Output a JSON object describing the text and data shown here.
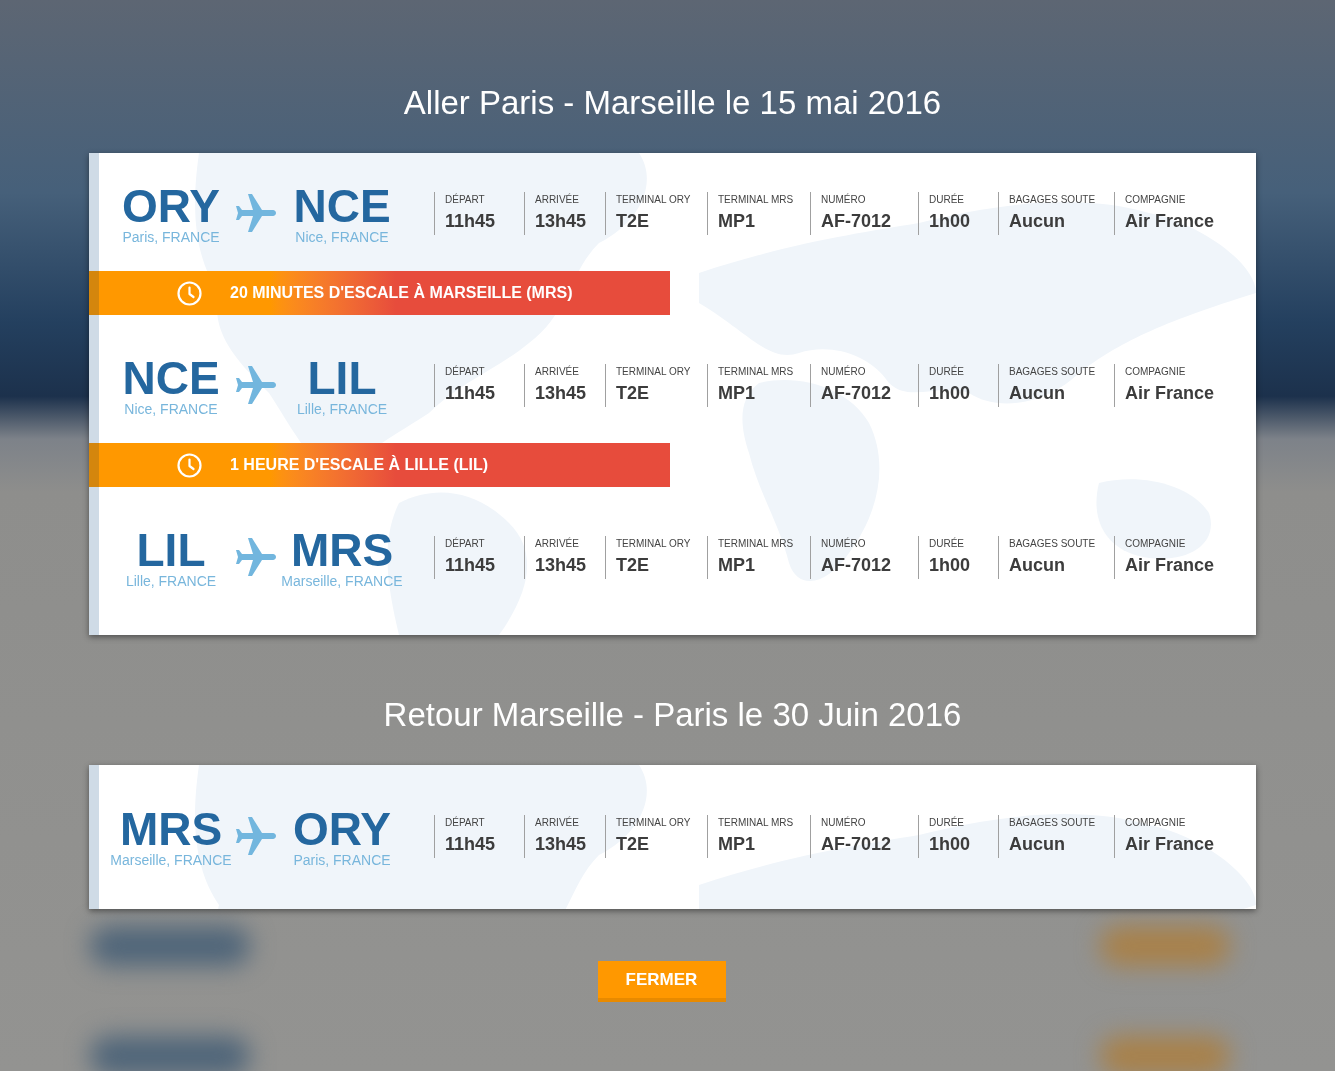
{
  "sections": [
    {
      "title": "Aller Paris - Marseille le 15 mai 2016",
      "legs": [
        {
          "kind": "flight",
          "origin": {
            "code": "ORY",
            "city": "Paris, FRANCE"
          },
          "destination": {
            "code": "NCE",
            "city": "Nice, FRANCE"
          },
          "details": [
            {
              "label": "DÉPART",
              "value": "11h45"
            },
            {
              "label": "ARRIVÉE",
              "value": "13h45"
            },
            {
              "label": "TERMINAL ORY",
              "value": "T2E"
            },
            {
              "label": "TERMINAL MRS",
              "value": "MP1"
            },
            {
              "label": "NUMÉRO",
              "value": "AF-7012"
            },
            {
              "label": "DURÉE",
              "value": "1h00"
            },
            {
              "label": "BAGAGES SOUTE",
              "value": "Aucun"
            },
            {
              "label": "COMPAGNIE",
              "value": "Air France"
            }
          ]
        },
        {
          "kind": "layover",
          "text": "20 MINUTES D'ESCALE À MARSEILLE (MRS)"
        },
        {
          "kind": "flight",
          "origin": {
            "code": "NCE",
            "city": "Nice, FRANCE"
          },
          "destination": {
            "code": "LIL",
            "city": "Lille, FRANCE"
          },
          "details": [
            {
              "label": "DÉPART",
              "value": "11h45"
            },
            {
              "label": "ARRIVÉE",
              "value": "13h45"
            },
            {
              "label": "TERMINAL ORY",
              "value": "T2E"
            },
            {
              "label": "TERMINAL MRS",
              "value": "MP1"
            },
            {
              "label": "NUMÉRO",
              "value": "AF-7012"
            },
            {
              "label": "DURÉE",
              "value": "1h00"
            },
            {
              "label": "BAGAGES SOUTE",
              "value": "Aucun"
            },
            {
              "label": "COMPAGNIE",
              "value": "Air France"
            }
          ]
        },
        {
          "kind": "layover",
          "text": "1 HEURE D'ESCALE À LILLE (LIL)"
        },
        {
          "kind": "flight",
          "origin": {
            "code": "LIL",
            "city": "Lille, FRANCE"
          },
          "destination": {
            "code": "MRS",
            "city": "Marseille, FRANCE"
          },
          "details": [
            {
              "label": "DÉPART",
              "value": "11h45"
            },
            {
              "label": "ARRIVÉE",
              "value": "13h45"
            },
            {
              "label": "TERMINAL ORY",
              "value": "T2E"
            },
            {
              "label": "TERMINAL MRS",
              "value": "MP1"
            },
            {
              "label": "NUMÉRO",
              "value": "AF-7012"
            },
            {
              "label": "DURÉE",
              "value": "1h00"
            },
            {
              "label": "BAGAGES SOUTE",
              "value": "Aucun"
            },
            {
              "label": "COMPAGNIE",
              "value": "Air France"
            }
          ]
        }
      ]
    },
    {
      "title": "Retour Marseille - Paris le 30 Juin 2016",
      "legs": [
        {
          "kind": "flight",
          "origin": {
            "code": "MRS",
            "city": "Marseille, FRANCE"
          },
          "destination": {
            "code": "ORY",
            "city": "Paris, FRANCE"
          },
          "details": [
            {
              "label": "DÉPART",
              "value": "11h45"
            },
            {
              "label": "ARRIVÉE",
              "value": "13h45"
            },
            {
              "label": "TERMINAL ORY",
              "value": "T2E"
            },
            {
              "label": "TERMINAL MRS",
              "value": "MP1"
            },
            {
              "label": "NUMÉRO",
              "value": "AF-7012"
            },
            {
              "label": "DURÉE",
              "value": "1h00"
            },
            {
              "label": "BAGAGES SOUTE",
              "value": "Aucun"
            },
            {
              "label": "COMPAGNIE",
              "value": "Air France"
            }
          ]
        }
      ]
    }
  ],
  "close_button": {
    "label": "FERMER"
  }
}
